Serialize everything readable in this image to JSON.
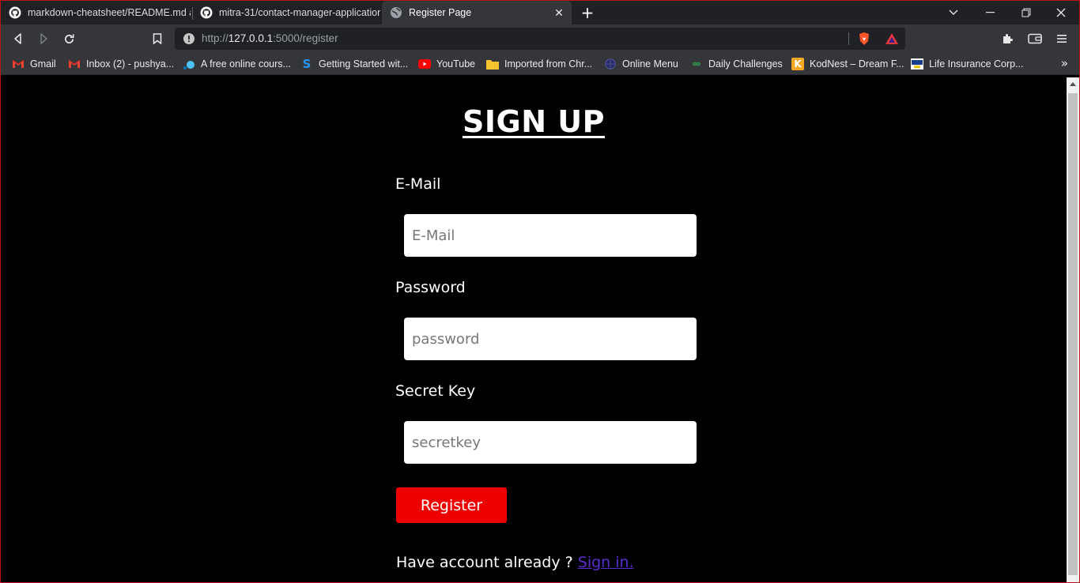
{
  "tabs": [
    {
      "title": "markdown-cheatsheet/README.md at",
      "icon": "github-icon"
    },
    {
      "title": "mitra-31/contact-manager-application",
      "icon": "github-icon"
    },
    {
      "title": "Register Page",
      "icon": "globe-icon",
      "active": true
    }
  ],
  "omnibox": {
    "scheme": "http://",
    "host": "127.0.0.1",
    "path": ":5000/register"
  },
  "bookmarks": [
    {
      "label": "Gmail",
      "icon": "gmail-icon"
    },
    {
      "label": "Inbox (2) - pushya...",
      "icon": "gmail-icon"
    },
    {
      "label": "A free online cours...",
      "icon": "dot-icon"
    },
    {
      "label": "Getting Started wit...",
      "icon": "s-logo-icon"
    },
    {
      "label": "YouTube",
      "icon": "youtube-icon"
    },
    {
      "label": "Imported from Chr...",
      "icon": "folder-icon"
    },
    {
      "label": "Online Menu",
      "icon": "menu-globe-icon"
    },
    {
      "label": "Daily Challenges",
      "icon": "infinity-icon"
    },
    {
      "label": "KodNest – Dream F...",
      "icon": "k-logo-icon"
    },
    {
      "label": "Life Insurance Corp...",
      "icon": "lic-logo-icon"
    }
  ],
  "page": {
    "heading": "SIGN UP",
    "email_label": "E-Mail",
    "email_placeholder": "E-Mail",
    "password_label": "Password",
    "password_placeholder": "password",
    "secret_label": "Secret Key",
    "secret_placeholder": "secretkey",
    "register_label": "Register",
    "have_account_text": "Have account already ?",
    "signin_link": "Sign in."
  },
  "colors": {
    "register_button": "#ee0000",
    "link": "#5b2ed1",
    "page_background": "#000000"
  }
}
